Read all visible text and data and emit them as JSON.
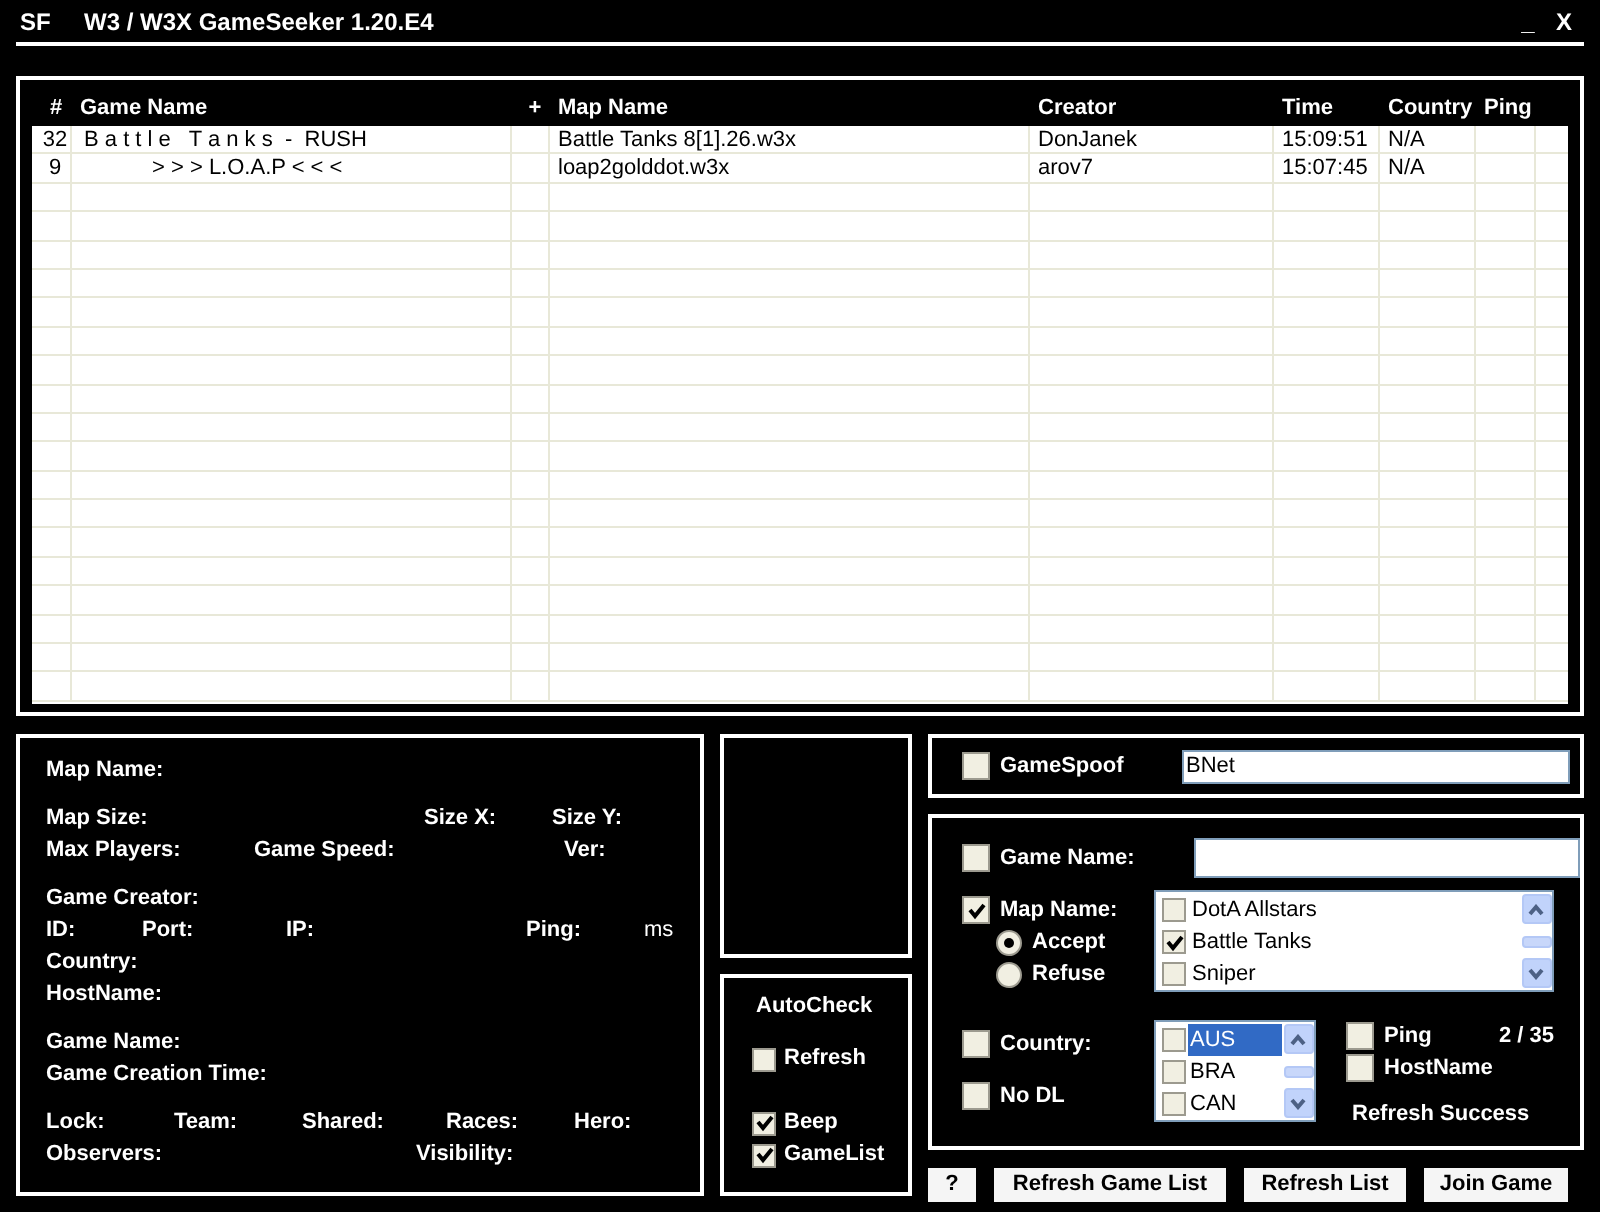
{
  "window": {
    "badge": "SF",
    "title": "W3 / W3X GameSeeker 1.20.E4",
    "controls": [
      "_",
      "X"
    ]
  },
  "game_table": {
    "columns": [
      "#",
      "Game Name",
      "+",
      "Map Name",
      "Creator",
      "Time",
      "Country",
      "Ping"
    ],
    "rows": [
      {
        "cells": [
          "32",
          "B a t t l e   T a n k s  -  RUSH",
          "",
          "Battle Tanks 8[1].26.w3x",
          "DonJanek",
          "15:09:51",
          "N/A",
          ""
        ]
      },
      {
        "cells": [
          "9",
          "> > > L.O.A.P < < <",
          "",
          "loap2golddot.w3x",
          "arov7",
          "15:07:45",
          "N/A",
          ""
        ]
      }
    ]
  },
  "details": {
    "groups": [
      [
        [
          {
            "text": "Map Name:"
          }
        ]
      ],
      [
        [
          {
            "text": "Map Size:"
          },
          {
            "text": "Size X:"
          },
          {
            "text": "Size Y:"
          }
        ],
        [
          {
            "text": "Max Players:"
          },
          {
            "text": "Game Speed:"
          },
          {
            "text": "Ver:"
          }
        ]
      ],
      [
        [
          {
            "text": "Game Creator:"
          }
        ],
        [
          {
            "text": "ID:"
          },
          {
            "text": "Port:"
          },
          {
            "text": "IP:"
          },
          {
            "text": "Ping:"
          },
          {
            "text": "ms",
            "kind": "unit"
          }
        ],
        [
          {
            "text": "Country:"
          }
        ],
        [
          {
            "text": "HostName:"
          }
        ]
      ],
      [
        [
          {
            "text": "Game Name:"
          }
        ],
        [
          {
            "text": "Game Creation Time:"
          }
        ]
      ],
      [
        [
          {
            "text": "Lock:"
          },
          {
            "text": "Team:"
          },
          {
            "text": "Shared:"
          },
          {
            "text": "Races:"
          },
          {
            "text": "Hero:"
          }
        ],
        [
          {
            "text": "Observers:"
          },
          {
            "text": "Visibility:"
          }
        ]
      ]
    ]
  },
  "autocheck": {
    "title": "AutoCheck",
    "options": [
      {
        "label": "Refresh",
        "checked": false
      },
      {
        "label": "Beep",
        "checked": true
      },
      {
        "label": "GameList",
        "checked": true
      }
    ]
  },
  "game_spoof": {
    "label": "GameSpoof",
    "checked": false,
    "value": "BNet"
  },
  "filters": {
    "game_name": {
      "label": "Game Name:",
      "checked": false
    },
    "map_name": {
      "label": "Map Name:",
      "checked": true,
      "modes": [
        {
          "label": "Accept",
          "selected": true
        },
        {
          "label": "Refuse",
          "selected": false
        }
      ],
      "maps": [
        {
          "label": "DotA Allstars",
          "checked": false
        },
        {
          "label": "Battle Tanks",
          "checked": true
        },
        {
          "label": "Sniper",
          "checked": false
        }
      ]
    },
    "country": {
      "label": "Country:",
      "checked": false,
      "countries": [
        {
          "label": "AUS",
          "checked": false,
          "selected": true
        },
        {
          "label": "BRA",
          "checked": false,
          "selected": false
        },
        {
          "label": "CAN",
          "checked": false,
          "selected": false
        }
      ]
    },
    "no_dl": {
      "label": "No DL",
      "checked": false
    },
    "ping": {
      "label": "Ping",
      "checked": false
    },
    "hostname": {
      "label": "HostName",
      "checked": false
    },
    "count": "2 / 35",
    "status": "Refresh Success"
  },
  "buttons": [
    "?",
    "Refresh Game List",
    "Refresh List",
    "Join Game"
  ]
}
